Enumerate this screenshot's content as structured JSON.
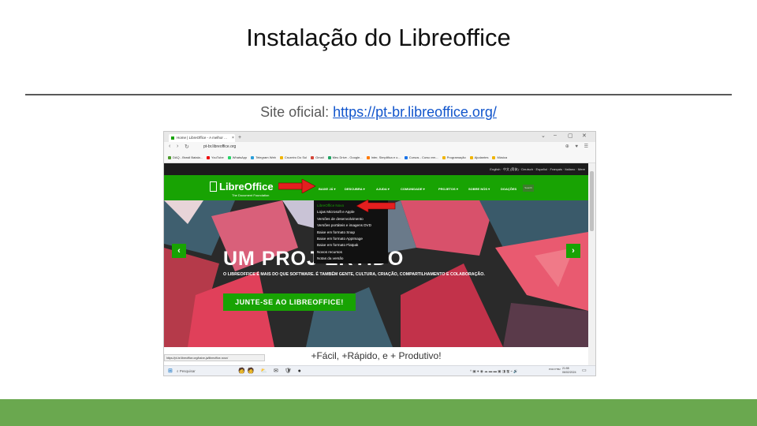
{
  "slide": {
    "title": "Instalação do Libreoffice",
    "site_label": "Site oficial: ",
    "site_url": "https://pt-br.libreoffice.org/",
    "accent_color": "#6aa84f"
  },
  "browser": {
    "tab_title": "Home | LibreOffice - A melhor ...",
    "tab_close": "×",
    "new_tab": "+",
    "window_controls": [
      "⌄",
      "–",
      "▢",
      "✕"
    ],
    "nav": {
      "back": "‹",
      "forward": "›",
      "reload": "↻"
    },
    "url": "pt-br.libreoffice.org",
    "addr_icons": "⊕ ♥ ☰",
    "bookmarks": [
      {
        "label": "DAQ - Brasil Batala...",
        "color": "#4a9a2a"
      },
      {
        "label": "YouTube",
        "color": "#e00"
      },
      {
        "label": "WhatsApp",
        "color": "#25d366"
      },
      {
        "label": "Telegram Web",
        "color": "#2a9ed8"
      },
      {
        "label": "Cruzeiro Do Sul",
        "color": "#f0b400"
      },
      {
        "label": "Gmail",
        "color": "#d44638"
      },
      {
        "label": "Meu Drive - Google...",
        "color": "#1fa463"
      },
      {
        "label": "Inter, Simplifica e o...",
        "color": "#ff7a00"
      },
      {
        "label": "Cursos - Curso em...",
        "color": "#1a73e8"
      },
      {
        "label": "Programação",
        "color": "#f0b400"
      },
      {
        "label": "Ajudantes",
        "color": "#f0b400"
      },
      {
        "label": "Música",
        "color": "#f0b400"
      }
    ]
  },
  "site": {
    "languages": "English · 中文 (简体) · Deutsch · Español · Français · Italiano · Mere",
    "logo": "LibreOffice",
    "logo_sub": "The Document Foundation",
    "nav": [
      "BAIXE JÁ ▾",
      "DESCUBRA ▾",
      "AJUDA ▾",
      "COMUNIDADE ▾",
      "PROJETOS ▾",
      "SOBRE NÓS ▾",
      "DOAÇÕES"
    ],
    "search": "Search",
    "dropdown": [
      "LibreOffice Novo",
      "Lojas Microsoft e Apple",
      "Versões de desenvolvimento",
      "Versões portáteis e imagens DVD",
      "Baixe em formato Snap",
      "Baixe em formato AppImage",
      "Baixe em formato Flatpak",
      "Novos recursos",
      "Notas da versão"
    ],
    "hero_title": "UM PROJ        ERTIDO",
    "hero_text": "O LIBREOFFICE É MAIS DO QUE SOFTWARE. É TAMBÉM GENTE, CULTURA, CRIAÇÃO, COMPARTILHAMENTO E COLABORAÇÃO.",
    "cta": "JUNTE-SE AO LIBREOFFICE!",
    "prev": "‹",
    "next": "›",
    "tagline": "+Fácil, +Rápido, e + Produtivo!",
    "status_url": "https://pt-br.libreoffice.org/baixe-ja/libreoffice-novo/"
  },
  "taskbar": {
    "start_icon": "windows-icon",
    "search_label": "⌕  Pesquisar",
    "apps": "🧑🧑 ⛅ ✉ 🛡 ●",
    "tray": "^ ▣ ● ◉ ☁ ▬ ▬ ▣ ◨ 🖫 ⌁ 🔊",
    "lang": "POR PTB2",
    "time": "21:55",
    "date": "06/02/2024"
  }
}
